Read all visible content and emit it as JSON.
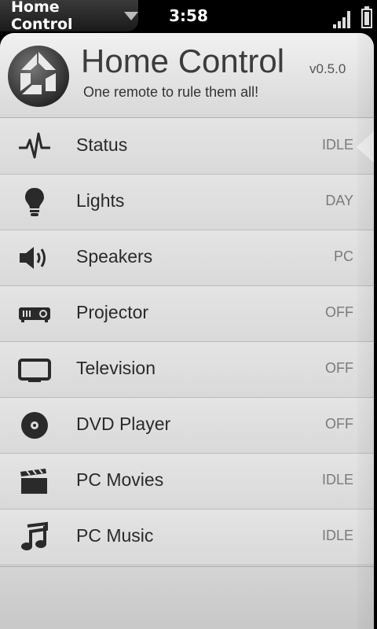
{
  "status_bar": {
    "app_menu_label": "Home Control",
    "clock": "3:58",
    "icons": [
      "chevron-down-icon",
      "signal-icon",
      "battery-icon"
    ]
  },
  "header": {
    "title": "Home Control",
    "version": "v0.5.0",
    "subtitle": "One remote to rule them all!"
  },
  "menu": [
    {
      "label": "Status",
      "state": "IDLE",
      "icon": "pulse-icon",
      "selected": true
    },
    {
      "label": "Lights",
      "state": "DAY",
      "icon": "lightbulb-icon"
    },
    {
      "label": "Speakers",
      "state": "PC",
      "icon": "speaker-icon"
    },
    {
      "label": "Projector",
      "state": "OFF",
      "icon": "projector-icon"
    },
    {
      "label": "Television",
      "state": "OFF",
      "icon": "television-icon"
    },
    {
      "label": "DVD Player",
      "state": "OFF",
      "icon": "disc-icon"
    },
    {
      "label": "PC Movies",
      "state": "IDLE",
      "icon": "clapperboard-icon"
    },
    {
      "label": "PC Music",
      "state": "IDLE",
      "icon": "music-note-icon"
    }
  ],
  "colors": {
    "background": "#dcdcdc",
    "text": "#2a2a2a",
    "state_text": "#7a7a7a",
    "status_bar": "#000000"
  }
}
